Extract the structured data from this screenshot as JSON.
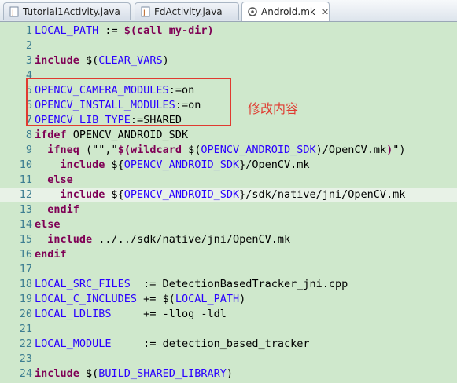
{
  "tabs": [
    {
      "label": "Tutorial1Activity.java",
      "icon": "java-file-icon",
      "active": false
    },
    {
      "label": "FdActivity.java",
      "icon": "java-file-icon",
      "active": false
    },
    {
      "label": "Android.mk",
      "icon": "makefile-icon",
      "active": true,
      "close": "✕"
    }
  ],
  "annotation": "修改内容",
  "lines": [
    {
      "n": "1",
      "parts": [
        [
          "LOCAL_PATH",
          1
        ],
        [
          " := ",
          0
        ],
        [
          "$(call my-dir)",
          2
        ]
      ]
    },
    {
      "n": "2",
      "parts": []
    },
    {
      "n": "3",
      "parts": [
        [
          "include",
          2
        ],
        [
          " $(",
          0
        ],
        [
          "CLEAR_VARS",
          1
        ],
        [
          ")",
          0
        ]
      ]
    },
    {
      "n": "4",
      "parts": []
    },
    {
      "n": "5",
      "parts": [
        [
          "OPENCV_CAMERA_MODULES",
          1
        ],
        [
          ":=on",
          0
        ]
      ]
    },
    {
      "n": "6",
      "parts": [
        [
          "OPENCV_INSTALL_MODULES",
          1
        ],
        [
          ":=on",
          0
        ]
      ]
    },
    {
      "n": "7",
      "parts": [
        [
          "OPENCV_LIB_TYPE",
          1
        ],
        [
          ":=SHARED",
          0
        ]
      ]
    },
    {
      "n": "8",
      "parts": [
        [
          "ifdef",
          2
        ],
        [
          " OPENCV_ANDROID_SDK",
          0
        ]
      ]
    },
    {
      "n": "9",
      "parts": [
        [
          "  ifneq",
          2
        ],
        [
          " (\"\",\"",
          0
        ],
        [
          "$(wildcard",
          2
        ],
        [
          " $(",
          0
        ],
        [
          "OPENCV_ANDROID_SDK",
          1
        ],
        [
          ")/OpenCV.mk",
          0
        ],
        [
          ")",
          2
        ],
        [
          "\")",
          0
        ]
      ]
    },
    {
      "n": "10",
      "parts": [
        [
          "    include",
          2
        ],
        [
          " ${",
          0
        ],
        [
          "OPENCV_ANDROID_SDK",
          1
        ],
        [
          "}/OpenCV.mk",
          0
        ]
      ]
    },
    {
      "n": "11",
      "parts": [
        [
          "  else",
          2
        ]
      ]
    },
    {
      "n": "12",
      "parts": [
        [
          "    include",
          2
        ],
        [
          " ${",
          0
        ],
        [
          "OPENCV_ANDROID_SDK",
          1
        ],
        [
          "}/sdk/native/jni/OpenCV.mk",
          0
        ]
      ]
    },
    {
      "n": "13",
      "parts": [
        [
          "  endif",
          2
        ]
      ]
    },
    {
      "n": "14",
      "parts": [
        [
          "else",
          2
        ]
      ]
    },
    {
      "n": "15",
      "parts": [
        [
          "  include",
          2
        ],
        [
          " ../../sdk/native/jni/OpenCV.mk",
          0
        ]
      ]
    },
    {
      "n": "16",
      "parts": [
        [
          "endif",
          2
        ]
      ]
    },
    {
      "n": "17",
      "parts": []
    },
    {
      "n": "18",
      "parts": [
        [
          "LOCAL_SRC_FILES",
          1
        ],
        [
          "  := DetectionBasedTracker_jni.cpp",
          0
        ]
      ]
    },
    {
      "n": "19",
      "parts": [
        [
          "LOCAL_C_INCLUDES",
          1
        ],
        [
          " += $(",
          0
        ],
        [
          "LOCAL_PATH",
          1
        ],
        [
          ")",
          0
        ]
      ]
    },
    {
      "n": "20",
      "parts": [
        [
          "LOCAL_LDLIBS",
          1
        ],
        [
          "     += -llog -ldl",
          0
        ]
      ]
    },
    {
      "n": "21",
      "parts": []
    },
    {
      "n": "22",
      "parts": [
        [
          "LOCAL_MODULE",
          1
        ],
        [
          "     := detection_based_tracker",
          0
        ]
      ]
    },
    {
      "n": "23",
      "parts": []
    },
    {
      "n": "24",
      "parts": [
        [
          "include",
          2
        ],
        [
          " $(",
          0
        ],
        [
          "BUILD_SHARED_LIBRARY",
          1
        ],
        [
          ")",
          0
        ]
      ]
    }
  ],
  "highlight_line": "12",
  "colors": {
    "annotation": "#e03a30",
    "keyword": "#7f0055",
    "variable": "#2a00ff",
    "line_number": "#3c7d91",
    "background": "#cfe8cc"
  }
}
